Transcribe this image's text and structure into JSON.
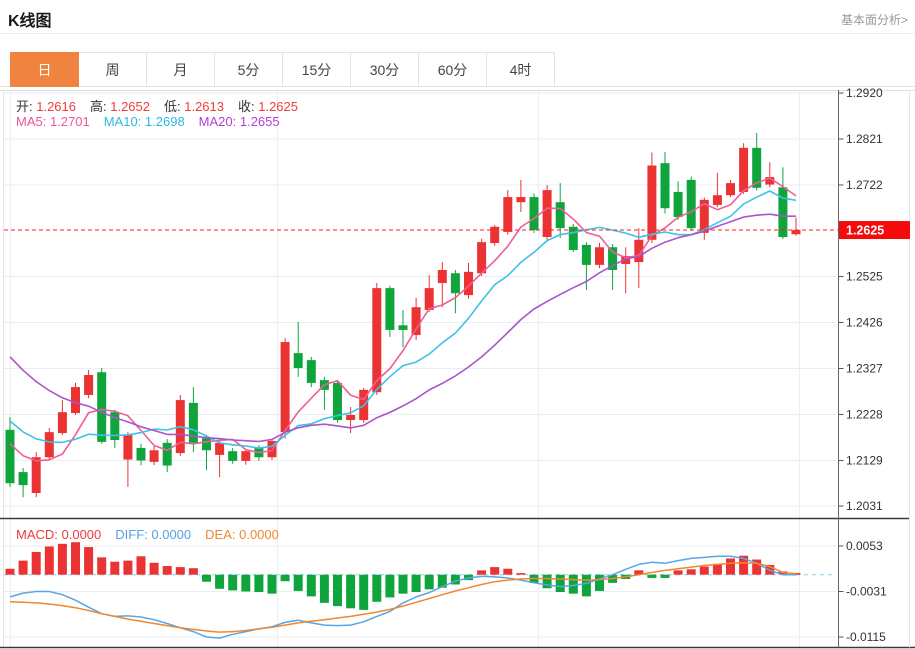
{
  "header": {
    "title": "K线图",
    "link": "基本面分析>"
  },
  "tabs": {
    "items": [
      "日",
      "周",
      "月",
      "5分",
      "15分",
      "30分",
      "60分",
      "4时"
    ],
    "active_index": 0,
    "active_color": "#f08340"
  },
  "readout": {
    "ohlc": [
      {
        "label": "开:",
        "value": "1.2616"
      },
      {
        "label": "高:",
        "value": "1.2652"
      },
      {
        "label": "低:",
        "value": "1.2613"
      },
      {
        "label": "收:",
        "value": "1.2625"
      }
    ],
    "ohlc_value_color": "#f03b3b",
    "ma": [
      {
        "label": "MA5:",
        "value": "1.2701",
        "color": "#f0549c"
      },
      {
        "label": "MA10:",
        "value": "1.2698",
        "color": "#2ab9e0"
      },
      {
        "label": "MA20:",
        "value": "1.2655",
        "color": "#b63ddb"
      }
    ],
    "macd": [
      {
        "label": "MACD:",
        "value": "0.0000",
        "color": "#ee3b3b"
      },
      {
        "label": "DIFF:",
        "value": "0.0000",
        "color": "#55a1e8"
      },
      {
        "label": "DEA:",
        "value": "0.0000",
        "color": "#f08930"
      }
    ]
  },
  "colors": {
    "up": "#ec3333",
    "down": "#0fa53c",
    "ma5": "#ef5e98",
    "ma10": "#3dc2e6",
    "ma20": "#aa55cc",
    "diff": "#58a6e8",
    "dea": "#ee8833",
    "grid": "#e8eef5",
    "axis_text": "#333333",
    "price_line": "#ff1e1e",
    "price_badge": "#f40b0b",
    "zero_line": "#aadcf0",
    "frame_dark": "#3a3a3a",
    "frame_light": "#e5e5e5"
  },
  "chart_data": {
    "type": "candlestick+macd",
    "title": "K线图 (daily K-line with MA5/MA10/MA20 overlays and MACD histogram)",
    "price_axis": {
      "ticks": [
        1.292,
        1.2821,
        1.2722,
        1.2525,
        1.2426,
        1.2327,
        1.2228,
        1.2129,
        1.2031
      ],
      "current_price": "1.2625",
      "ylim": [
        1.2031,
        1.292
      ],
      "grid": true,
      "legend_position": "top-left"
    },
    "macd_axis": {
      "ticks": [
        0.0053,
        -0.0031,
        -0.0115
      ],
      "tick_labels": [
        "0.0053",
        "-0.0031",
        "-0.0115"
      ],
      "zero_dashed": true
    },
    "candles_format": "[open, high, low, close]",
    "candles": [
      [
        1.2195,
        1.2222,
        1.2072,
        1.208
      ],
      [
        1.2104,
        1.2113,
        1.205,
        1.2076
      ],
      [
        1.2059,
        1.2147,
        1.205,
        1.2136
      ],
      [
        1.2136,
        1.2199,
        1.213,
        1.219
      ],
      [
        1.2188,
        1.2259,
        1.2184,
        1.2233
      ],
      [
        1.2231,
        1.2296,
        1.2227,
        1.2287
      ],
      [
        1.227,
        1.2324,
        1.2263,
        1.2313
      ],
      [
        1.2319,
        1.2328,
        1.2165,
        1.2169
      ],
      [
        1.2233,
        1.2238,
        1.2156,
        1.2173
      ],
      [
        1.2131,
        1.219,
        1.2072,
        1.2184
      ],
      [
        1.2156,
        1.2165,
        1.2119,
        1.2129
      ],
      [
        1.2126,
        1.216,
        1.2119,
        1.2151
      ],
      [
        1.2167,
        1.2175,
        1.2104,
        1.2118
      ],
      [
        1.2145,
        1.227,
        1.2139,
        1.2259
      ],
      [
        1.2253,
        1.2287,
        1.2147,
        1.2167
      ],
      [
        1.2177,
        1.2184,
        1.2108,
        1.2151
      ],
      [
        1.2141,
        1.2171,
        1.2093,
        1.2167
      ],
      [
        1.2149,
        1.2156,
        1.2122,
        1.2128
      ],
      [
        1.2128,
        1.2154,
        1.212,
        1.2149
      ],
      [
        1.2156,
        1.2162,
        1.2128,
        1.2136
      ],
      [
        1.2136,
        1.2176,
        1.213,
        1.2171
      ],
      [
        1.219,
        1.2392,
        1.2176,
        1.2384
      ],
      [
        1.236,
        1.2427,
        1.2309,
        1.2328
      ],
      [
        1.2345,
        1.2352,
        1.2287,
        1.2296
      ],
      [
        1.2302,
        1.2309,
        1.2238,
        1.2281
      ],
      [
        1.2296,
        1.2302,
        1.221,
        1.2216
      ],
      [
        1.2216,
        1.2244,
        1.2188,
        1.2227
      ],
      [
        1.2216,
        1.2285,
        1.221,
        1.2281
      ],
      [
        1.2276,
        1.2511,
        1.227,
        1.25
      ],
      [
        1.25,
        1.2505,
        1.2395,
        1.241
      ],
      [
        1.242,
        1.2453,
        1.2373,
        1.241
      ],
      [
        1.2399,
        1.2479,
        1.2388,
        1.2459
      ],
      [
        1.2453,
        1.2528,
        1.2449,
        1.25
      ],
      [
        1.2511,
        1.2556,
        1.2459,
        1.2539
      ],
      [
        1.2532,
        1.2539,
        1.2446,
        1.2489
      ],
      [
        1.2485,
        1.2554,
        1.2477,
        1.2535
      ],
      [
        1.2532,
        1.2606,
        1.2526,
        1.2599
      ],
      [
        1.2597,
        1.2636,
        1.2591,
        1.2632
      ],
      [
        1.2621,
        1.2711,
        1.2615,
        1.2696
      ],
      [
        1.2685,
        1.2733,
        1.2664,
        1.2696
      ],
      [
        1.2696,
        1.2704,
        1.2619,
        1.2625
      ],
      [
        1.261,
        1.2722,
        1.2604,
        1.2711
      ],
      [
        1.2685,
        1.2726,
        1.2608,
        1.2629
      ],
      [
        1.2632,
        1.2638,
        1.2578,
        1.2582
      ],
      [
        1.2593,
        1.2599,
        1.2496,
        1.255
      ],
      [
        1.255,
        1.2597,
        1.2543,
        1.2588
      ],
      [
        1.2588,
        1.2595,
        1.2496,
        1.2539
      ],
      [
        1.2552,
        1.2588,
        1.2489,
        1.2569
      ],
      [
        1.2556,
        1.2629,
        1.25,
        1.2604
      ],
      [
        1.2604,
        1.2792,
        1.2597,
        1.2764
      ],
      [
        1.2769,
        1.2793,
        1.2661,
        1.2672
      ],
      [
        1.2707,
        1.273,
        1.2647,
        1.2653
      ],
      [
        1.2733,
        1.274,
        1.2623,
        1.2629
      ],
      [
        1.2619,
        1.2695,
        1.2604,
        1.269
      ],
      [
        1.2679,
        1.2748,
        1.2674,
        1.27
      ],
      [
        1.27,
        1.2733,
        1.2696,
        1.2726
      ],
      [
        1.2707,
        1.2812,
        1.2703,
        1.2802
      ],
      [
        1.2802,
        1.2834,
        1.271,
        1.2716
      ],
      [
        1.2723,
        1.2771,
        1.2717,
        1.2739
      ],
      [
        1.2717,
        1.276,
        1.2606,
        1.261
      ],
      [
        1.2616,
        1.2652,
        1.2613,
        1.2625
      ]
    ],
    "pre_closes": [
      1.27,
      1.266,
      1.262,
      1.258,
      1.254,
      1.25,
      1.2465,
      1.243,
      1.24,
      1.237,
      1.234,
      1.231,
      1.2285,
      1.226,
      1.224,
      1.222,
      1.2205,
      1.219,
      1.218,
      1.217
    ],
    "ma_windows": [
      5,
      10,
      20
    ],
    "macd": {
      "hist": [
        0.0011,
        0.0026,
        0.0042,
        0.0052,
        0.0057,
        0.006,
        0.0051,
        0.0032,
        0.0024,
        0.0026,
        0.0034,
        0.0022,
        0.0016,
        0.0014,
        0.0012,
        -0.0013,
        -0.0026,
        -0.0029,
        -0.0031,
        -0.0032,
        -0.0035,
        -0.0012,
        -0.003,
        -0.004,
        -0.0052,
        -0.0058,
        -0.0062,
        -0.0065,
        -0.005,
        -0.0042,
        -0.0035,
        -0.0032,
        -0.0027,
        -0.0024,
        -0.0018,
        -0.001,
        0.0008,
        0.0014,
        0.0011,
        0.0003,
        -0.0015,
        -0.0025,
        -0.0032,
        -0.0035,
        -0.004,
        -0.003,
        -0.0015,
        -0.0008,
        0.0008,
        -0.0006,
        -0.0006,
        0.0008,
        0.001,
        0.0015,
        0.002,
        0.003,
        0.0035,
        0.0028,
        0.0018,
        0.0006,
        0.0003
      ],
      "diff": [
        -0.0041,
        -0.0034,
        -0.0031,
        -0.0031,
        -0.0037,
        -0.0047,
        -0.006,
        -0.0072,
        -0.0077,
        -0.0076,
        -0.0078,
        -0.0083,
        -0.009,
        -0.0098,
        -0.0105,
        -0.0115,
        -0.0117,
        -0.011,
        -0.0105,
        -0.01,
        -0.0096,
        -0.0088,
        -0.0084,
        -0.0089,
        -0.0093,
        -0.0094,
        -0.0093,
        -0.0087,
        -0.0077,
        -0.0068,
        -0.0052,
        -0.0041,
        -0.0033,
        -0.0022,
        -0.0012,
        -0.0006,
        -0.0003,
        -0.0004,
        -0.0006,
        -0.001,
        -0.0015,
        -0.0019,
        -0.0022,
        -0.002,
        -0.0016,
        -0.0008,
        0.0,
        0.001,
        0.0019,
        0.0023,
        0.0021,
        0.0026,
        0.003,
        0.0032,
        0.0034,
        0.0034,
        0.003,
        0.0021,
        0.0008,
        0.0,
        0.0
      ],
      "dea": [
        -0.005,
        -0.0051,
        -0.0052,
        -0.0054,
        -0.0057,
        -0.0061,
        -0.0066,
        -0.0072,
        -0.0077,
        -0.0082,
        -0.0086,
        -0.009,
        -0.0094,
        -0.0098,
        -0.0101,
        -0.0104,
        -0.0106,
        -0.0105,
        -0.0103,
        -0.01,
        -0.0097,
        -0.0093,
        -0.0089,
        -0.0086,
        -0.0083,
        -0.008,
        -0.0077,
        -0.0073,
        -0.0069,
        -0.0064,
        -0.0058,
        -0.0051,
        -0.0044,
        -0.0037,
        -0.003,
        -0.0024,
        -0.0018,
        -0.0013,
        -0.001,
        -0.0008,
        -0.0007,
        -0.0007,
        -0.0008,
        -0.0009,
        -0.001,
        -0.0009,
        -0.0007,
        -0.0004,
        0.0,
        0.0004,
        0.0008,
        0.0011,
        0.0014,
        0.0017,
        0.0019,
        0.0021,
        0.0022,
        0.0021,
        0.0015,
        0.0004,
        0.0002
      ]
    }
  }
}
